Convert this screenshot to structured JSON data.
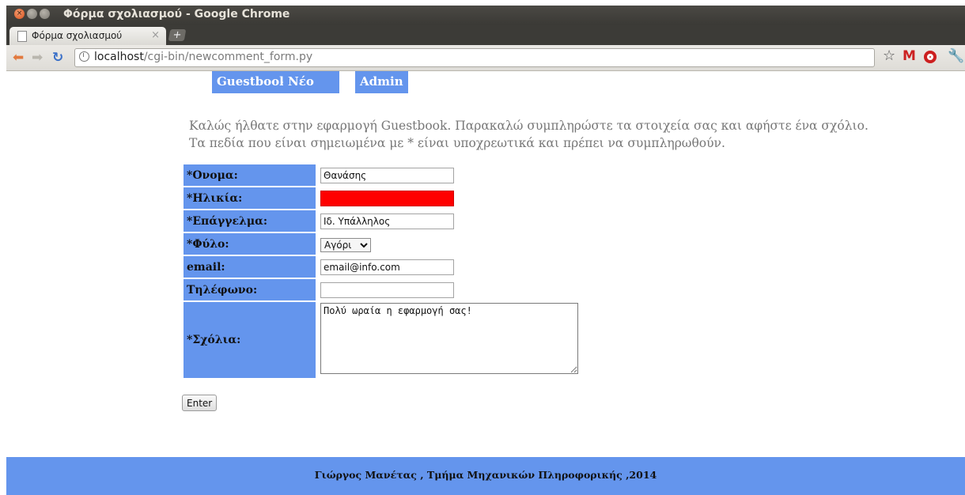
{
  "window": {
    "title": "Φόρμα σχολιασμού - Google Chrome"
  },
  "tab": {
    "label": "Φόρμα σχολιασμού",
    "close_glyph": "×",
    "new_tab_glyph": "+"
  },
  "address_bar": {
    "host": "localhost",
    "path": "/cgi-bin/newcomment_form.py"
  },
  "nav": [
    "Guestbook",
    "Νέο σχόλιο",
    "Admin"
  ],
  "welcome": {
    "line1": "Καλώς ήλθατε στην εφαρμογή Guestbook. Παρακαλώ συμπληρώστε τα στοιχεία σας και αφήστε ένα σχόλιο.",
    "line2": "Τα πεδία που είναι σημειωμένα με * είναι υποχρεωτικά και πρέπει να συμπληρωθούν."
  },
  "form": {
    "name": {
      "label": "*Ονομα:",
      "value": "Θανάσης"
    },
    "age": {
      "label": "*Ηλικία:",
      "value": "",
      "error_color": "#ff0000"
    },
    "job": {
      "label": "*Επάγγελμα:",
      "value": "Ιδ. Υπάλληλος"
    },
    "gender": {
      "label": "*Φύλο:",
      "value": "Αγόρι"
    },
    "email": {
      "label": "email:",
      "value": "email@info.com"
    },
    "phone": {
      "label": "Τηλέφωνο:",
      "value": ""
    },
    "comments": {
      "label": "*Σχόλια:",
      "value": "Πολύ ωραία η εφαρμογή σας!"
    },
    "submit_label": "Enter"
  },
  "footer": {
    "text": "Γιώργος Μανέτας , Τμήμα Μηχανικών Πληροφορικής ,2014"
  },
  "colors": {
    "accent": "#6495ED",
    "error": "#ff0000"
  },
  "icons": [
    "close-window-icon",
    "minimize-window-icon",
    "maximize-window-icon",
    "page-icon",
    "back-arrow-icon",
    "forward-arrow-icon",
    "reload-icon",
    "info-icon",
    "bookmark-star-icon",
    "gmail-icon",
    "opera-icon",
    "wrench-icon"
  ]
}
